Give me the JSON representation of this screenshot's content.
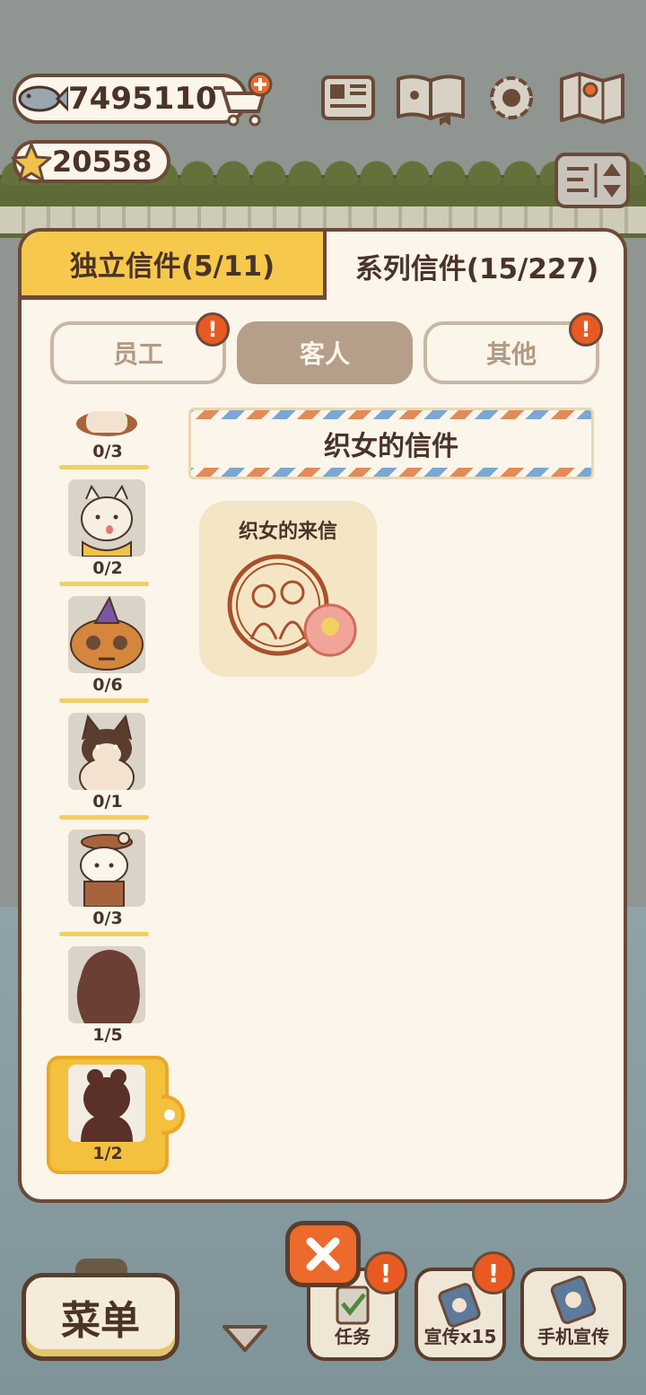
{
  "currency": {
    "fish_count": "7495110",
    "star_count": "20558"
  },
  "tabs": {
    "independent": "独立信件(5/11)",
    "series": "系列信件(15/227)"
  },
  "subtabs": {
    "staff": "员工",
    "guest": "客人",
    "other": "其他",
    "badge_mark": "!"
  },
  "list": {
    "items": [
      {
        "count": "0/3",
        "icon": "dog-in-costume-portrait"
      },
      {
        "count": "0/2",
        "icon": "white-dog-portrait"
      },
      {
        "count": "0/6",
        "icon": "pumpkin-witch-portrait"
      },
      {
        "count": "0/1",
        "icon": "shiba-dog-portrait"
      },
      {
        "count": "0/3",
        "icon": "white-cat-with-hat-portrait"
      },
      {
        "count": "1/5",
        "icon": "silhouette-portrait"
      },
      {
        "count": "1/2",
        "icon": "bear-silhouette-portrait"
      }
    ]
  },
  "letter": {
    "section_title": "织女的信件",
    "card_title": "织女的来信"
  },
  "bottom": {
    "menu": "菜单",
    "task": "任务",
    "promo": "宣传x15",
    "phone_promo": "手机宣传",
    "badge_mark": "!"
  },
  "colors": {
    "panel_bg": "#fbf5ea",
    "outline": "#6b4a38",
    "tab_active": "#f6c94c",
    "subtab_active": "#b59f8b",
    "badge": "#e85a22",
    "close_button": "#ec6a2b"
  }
}
